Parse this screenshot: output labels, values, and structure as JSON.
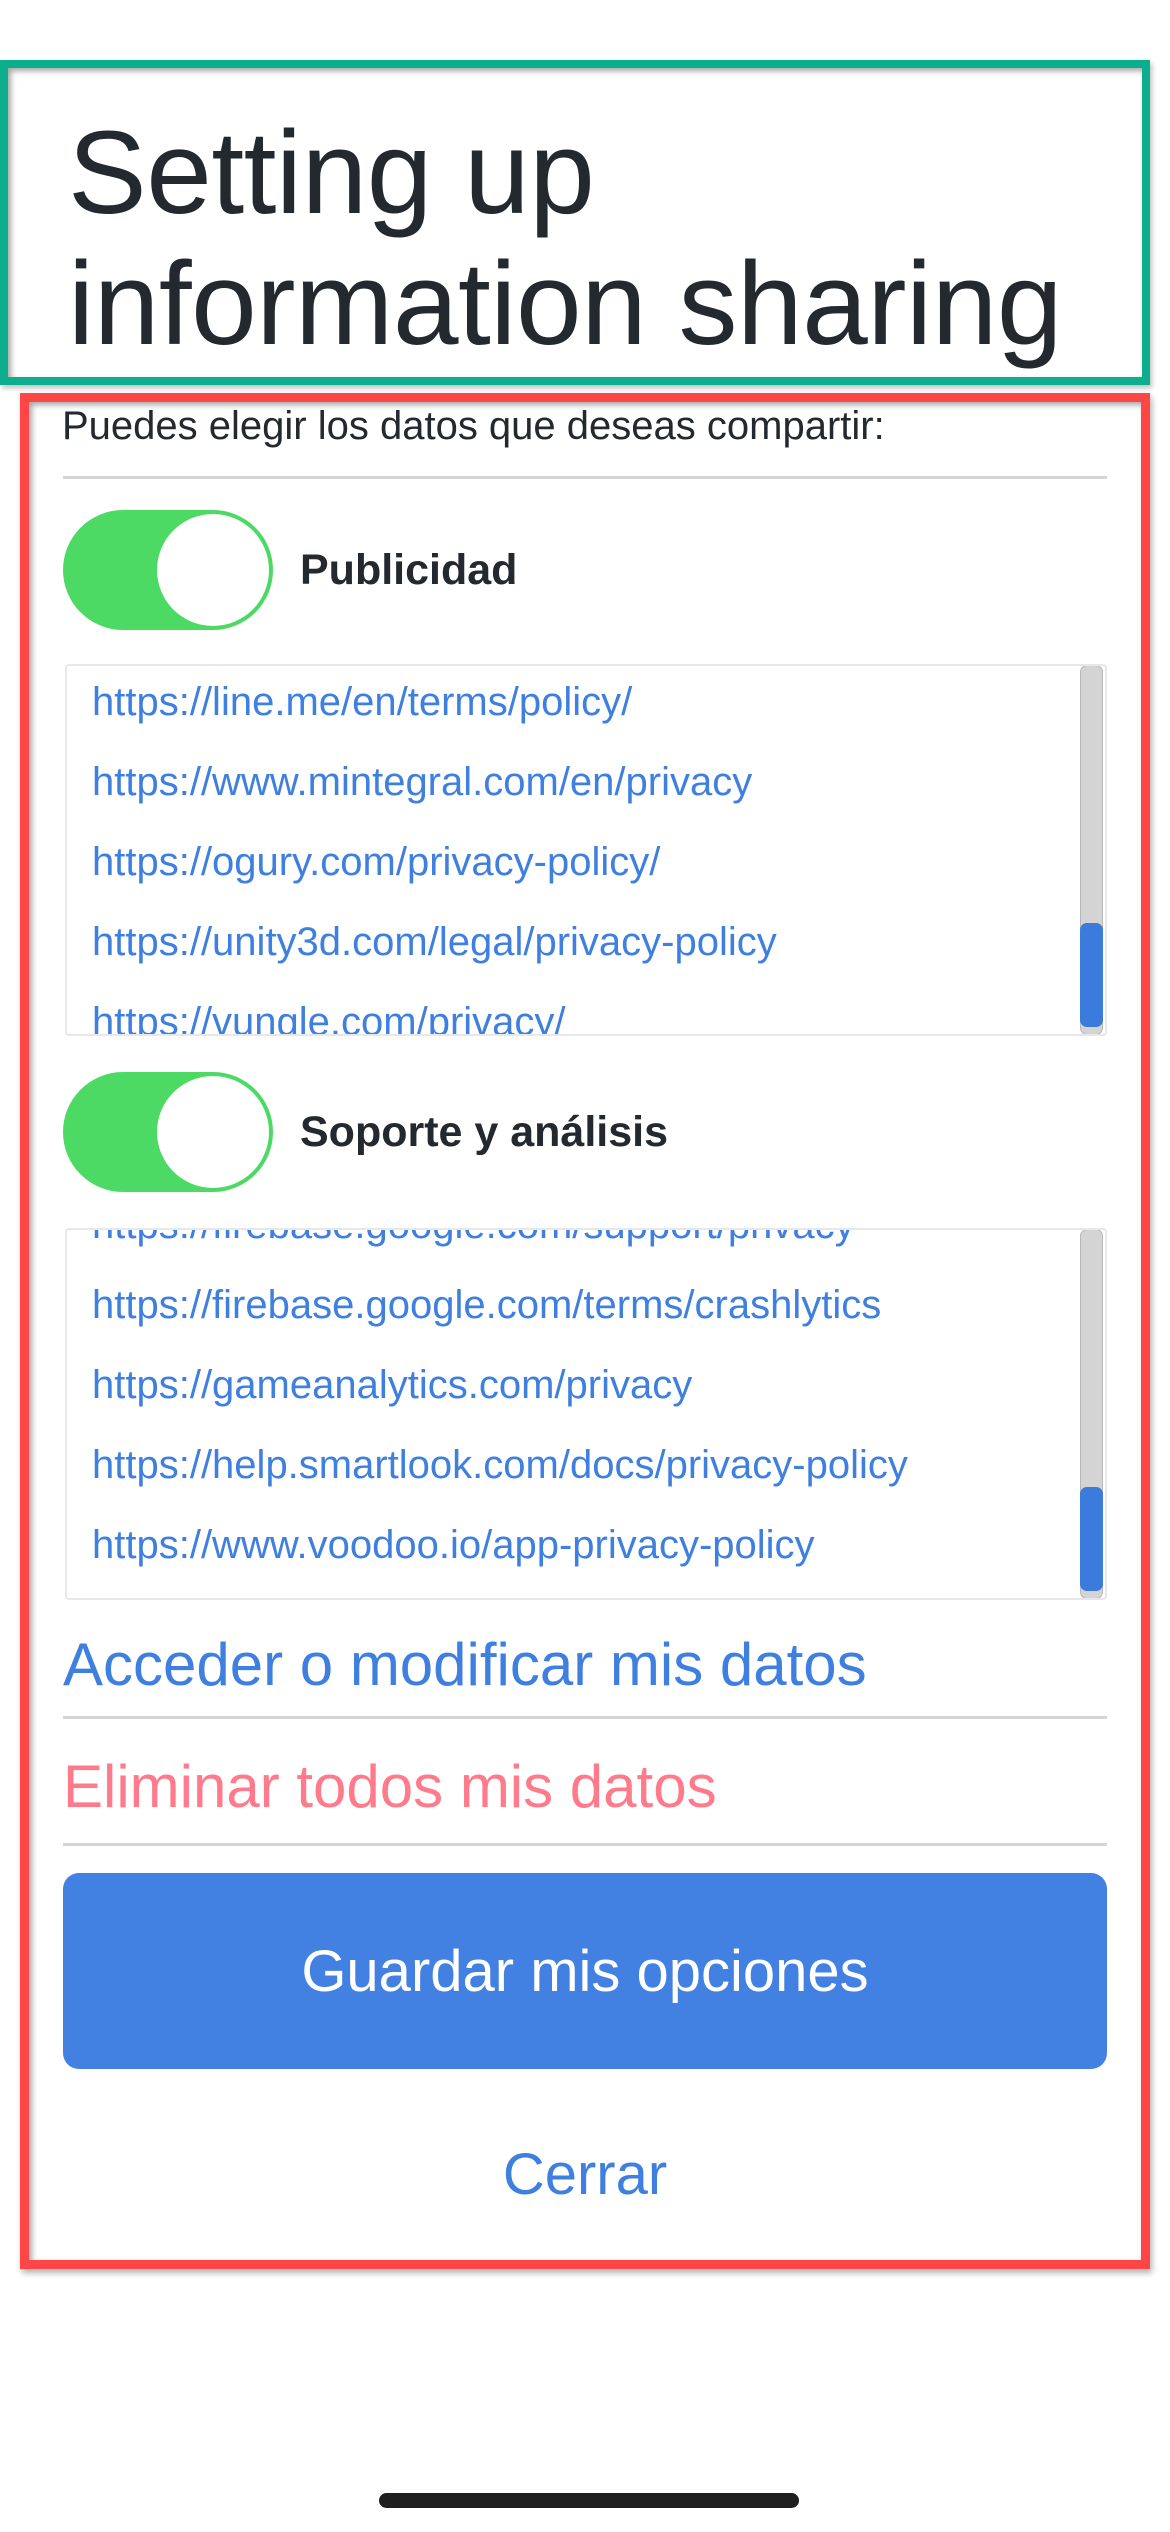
{
  "header": {
    "title_line1": "Setting up",
    "title_line2": "information sharing"
  },
  "intro": "Puedes elegir los datos que deseas compartir:",
  "sections": [
    {
      "label": "Publicidad",
      "toggle_on": true,
      "urls": [
        "https://line.me/en/terms/policy/",
        "https://www.mintegral.com/en/privacy",
        "https://ogury.com/privacy-policy/",
        "https://unity3d.com/legal/privacy-policy",
        "https://vungle.com/privacy/"
      ],
      "scroll_position_fraction": 1.0
    },
    {
      "label": "Soporte y análisis",
      "toggle_on": true,
      "urls": [
        "https://firebase.google.com/support/privacy",
        "https://firebase.google.com/terms/crashlytics",
        "https://gameanalytics.com/privacy",
        "https://help.smartlook.com/docs/privacy-policy",
        "https://www.voodoo.io/app-privacy-policy"
      ],
      "scroll_position_fraction": 1.0
    }
  ],
  "actions": {
    "access_modify": "Acceder o modificar mis datos",
    "delete_all": "Eliminar todos mis datos",
    "save": "Guardar mis opciones",
    "close": "Cerrar"
  },
  "colors": {
    "title_outline": "#0DAE8E",
    "content_outline": "#FF4646",
    "toggle_on": "#4CD964",
    "link_blue": "#3E7FE0",
    "danger_link": "#FF7A8A",
    "primary_button": "#4281E2",
    "text": "#23292E"
  }
}
